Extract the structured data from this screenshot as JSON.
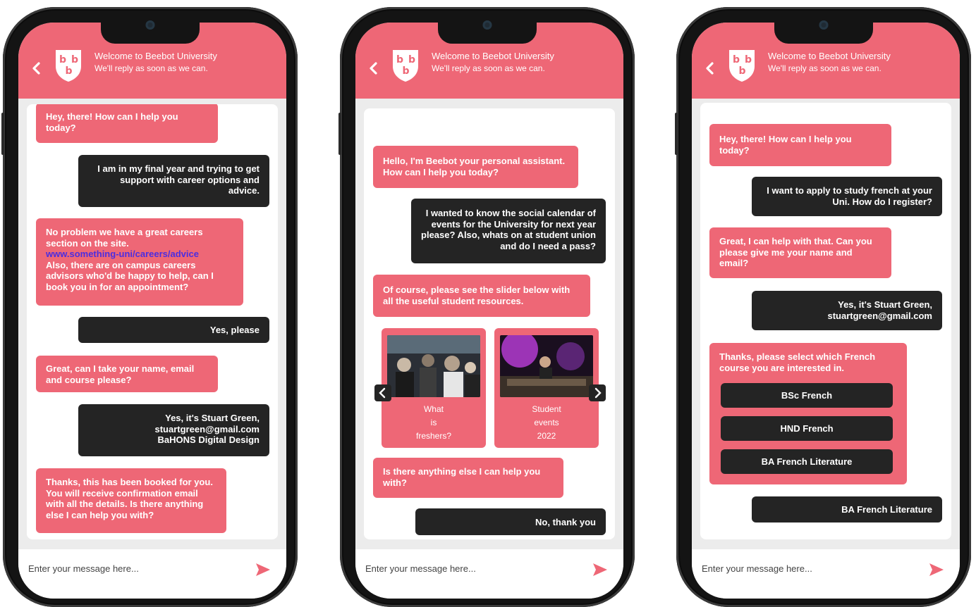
{
  "header": {
    "title": "Welcome to Beebot University",
    "subtitle": "We'll reply as soon as we can."
  },
  "input": {
    "placeholder": "Enter your message here..."
  },
  "colors": {
    "brand": "#ee6776",
    "user_bubble": "#242424",
    "link": "#4b2de0"
  },
  "icons": {
    "back": "chevron-left-icon",
    "logo": "beebot-shield-logo",
    "send": "send-icon",
    "slider_prev": "chevron-left-icon",
    "slider_next": "chevron-right-icon"
  },
  "phone1": {
    "m1": "Hey, there! How can I help you today?",
    "m2": "I am in my final year and trying to get support with career options and advice.",
    "m3_a": "No problem we have a great careers section on the site.",
    "m3_link": "www.something-uni/careers/advice",
    "m3_b": "Also, there are on campus careers advisors who'd be happy to help, can I book you in for an appointment?",
    "m4": "Yes, please",
    "m5": "Great, can I take your name, email and course please?",
    "m6_l1": "Yes, it's Stuart Green,",
    "m6_l2": "stuartgreen@gmail.com",
    "m6_l3": "BaHONS Digital Design",
    "m7": "Thanks, this has been booked for you. You will receive confirmation email with all the details. Is there anything else I can help you with?"
  },
  "phone2": {
    "m1": "Hello, I'm Beebot your personal assistant. How can I help you today?",
    "m2": "I wanted to know the social calendar of events for the University for next year please? Also, whats on at student union and do I need a pass?",
    "m3": "Of course, please see the slider below with all the useful student resources.",
    "slides": [
      {
        "cap1": "What",
        "cap2": "is",
        "cap3": "freshers?"
      },
      {
        "cap1": "Student",
        "cap2": "events",
        "cap3": "2022"
      }
    ],
    "m4": "Is there anything else I can help you with?",
    "m5": "No, thank you"
  },
  "phone3": {
    "m1": "Hey, there! How can I help you today?",
    "m2": "I want to apply to study french at your Uni. How do I register?",
    "m3": "Great, I can help with that. Can you please give me your name and email?",
    "m4_l1": "Yes, it's Stuart Green,",
    "m4_l2": "stuartgreen@gmail.com",
    "m5": "Thanks, please select which French course you are interested in.",
    "options": [
      "BSc French",
      "HND French",
      "BA French Literature"
    ],
    "m6": "BA French Literature"
  }
}
